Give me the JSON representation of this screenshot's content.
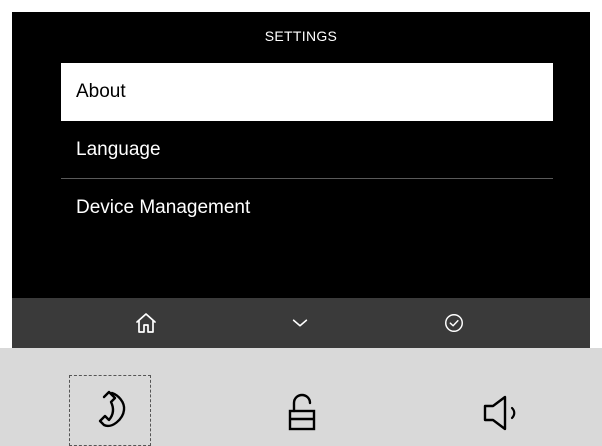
{
  "screen": {
    "title": "SETTINGS",
    "menu": [
      {
        "label": "About",
        "selected": true
      },
      {
        "label": "Language",
        "selected": false
      },
      {
        "label": "Device Management",
        "selected": false
      }
    ]
  },
  "navbar": {
    "buttons": [
      "home-icon",
      "chevron-down-icon",
      "check-circle-icon"
    ]
  },
  "panel": {
    "buttons": [
      "phone-icon",
      "unlock-icon",
      "speaker-icon"
    ],
    "focused": "phone-icon"
  },
  "colors": {
    "screen_background": "#000000",
    "selected_item_background": "#ffffff",
    "navbar_background": "#3a3a3a",
    "panel_background": "#d9d9d9"
  }
}
